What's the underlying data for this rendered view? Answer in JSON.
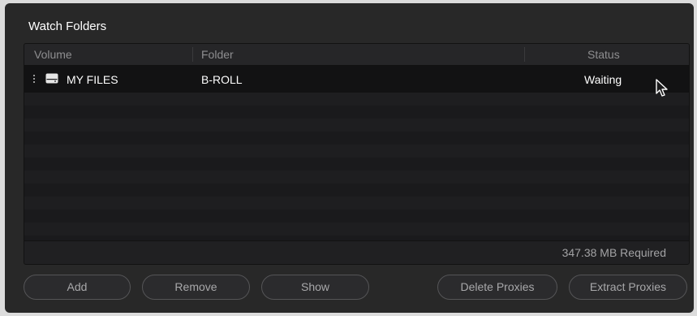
{
  "panel": {
    "title": "Watch Folders"
  },
  "table": {
    "columns": [
      "Volume",
      "Folder",
      "Status"
    ],
    "rows": [
      {
        "volume": "MY FILES",
        "folder": "B-ROLL",
        "status": "Waiting",
        "volume_icon": "drive-icon"
      }
    ],
    "footer": "347.38 MB Required"
  },
  "buttons": {
    "add": "Add",
    "remove": "Remove",
    "show": "Show",
    "delete_proxies": "Delete Proxies",
    "extract_proxies": "Extract Proxies"
  },
  "colors": {
    "panel_bg": "#282828",
    "table_bg": "#1b1b1c",
    "text_primary": "#ffffff",
    "text_muted": "#8e8e90"
  }
}
